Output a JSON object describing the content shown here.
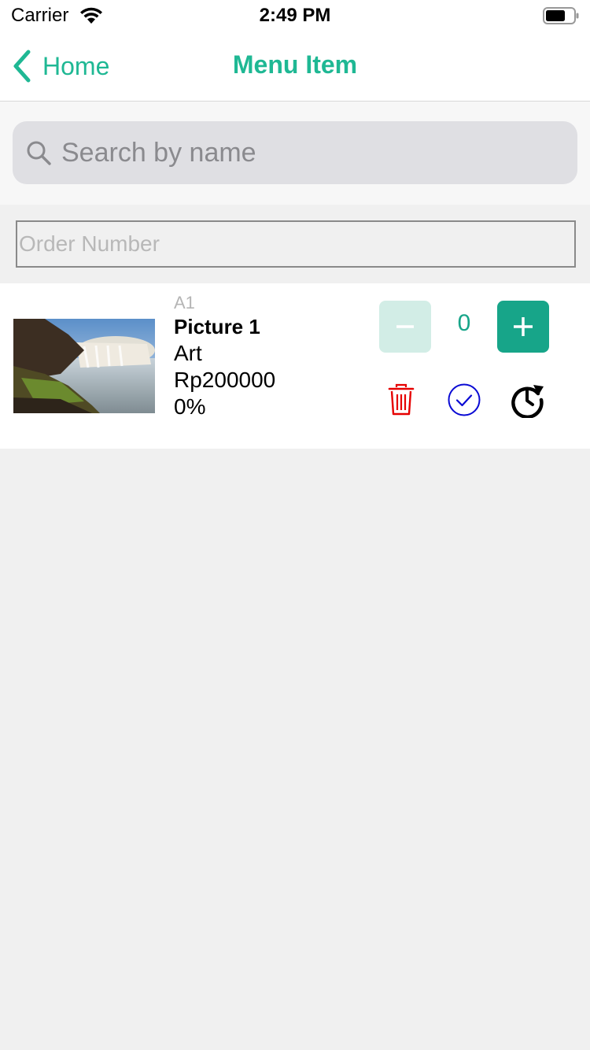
{
  "status_bar": {
    "carrier": "Carrier",
    "time": "2:49 PM"
  },
  "nav": {
    "back_label": "Home",
    "title": "Menu Item"
  },
  "search": {
    "placeholder": "Search by name"
  },
  "order": {
    "placeholder": "Order Number"
  },
  "item": {
    "code": "A1",
    "name": "Picture 1",
    "category": "Art",
    "price": "Rp200000",
    "discount": "0%",
    "quantity": "0"
  },
  "colors": {
    "accent": "#1fb894",
    "button_green": "#17a589",
    "button_disabled": "#d2ede6",
    "delete": "#e60000",
    "check": "#0a0ad4"
  },
  "icons": [
    "wifi-icon",
    "battery-icon",
    "chevron-left-icon",
    "search-icon",
    "minus-icon",
    "plus-icon",
    "trash-icon",
    "check-circle-icon",
    "history-clock-icon"
  ]
}
